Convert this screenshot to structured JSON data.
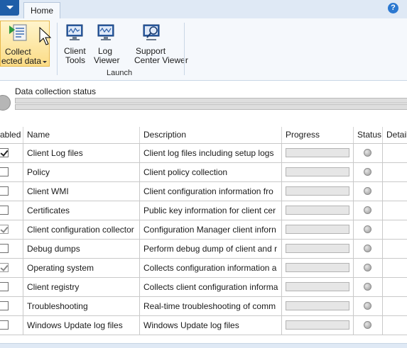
{
  "ribbon": {
    "tab_home": "Home",
    "help_label": "?",
    "collect": {
      "line1": "Collect",
      "line2": "ected data"
    },
    "client_tools": {
      "line1": "Client",
      "line2": "Tools"
    },
    "log_viewer": {
      "line1": "Log",
      "line2": "Viewer"
    },
    "support_center_viewer": {
      "line1": "Support",
      "line2": "Center Viewer"
    },
    "group_launch": "Launch"
  },
  "status": {
    "title": "Data collection status"
  },
  "table": {
    "columns": {
      "enabled": "abled",
      "name": "Name",
      "description": "Description",
      "progress": "Progress",
      "status": "Status",
      "details": "Detail"
    },
    "rows": [
      {
        "checked": true,
        "dim": false,
        "name": "Client Log files",
        "description": "Client log files including setup logs"
      },
      {
        "checked": false,
        "dim": false,
        "name": "Policy",
        "description": "Client policy collection"
      },
      {
        "checked": false,
        "dim": false,
        "name": "Client WMI",
        "description": "Client configuration information fro"
      },
      {
        "checked": false,
        "dim": false,
        "name": "Certificates",
        "description": "Public key information for client cer"
      },
      {
        "checked": true,
        "dim": true,
        "name": "Client configuration collector",
        "description": "Configuration Manager client inforn"
      },
      {
        "checked": false,
        "dim": false,
        "name": "Debug dumps",
        "description": "Perform debug dump of client and r"
      },
      {
        "checked": true,
        "dim": true,
        "name": "Operating system",
        "description": "Collects configuration information a"
      },
      {
        "checked": false,
        "dim": false,
        "name": "Client registry",
        "description": "Collects client configuration informa"
      },
      {
        "checked": false,
        "dim": false,
        "name": "Troubleshooting",
        "description": "Real-time troubleshooting of comm"
      },
      {
        "checked": false,
        "dim": false,
        "name": "Windows Update log files",
        "description": "Windows Update log files"
      }
    ]
  }
}
